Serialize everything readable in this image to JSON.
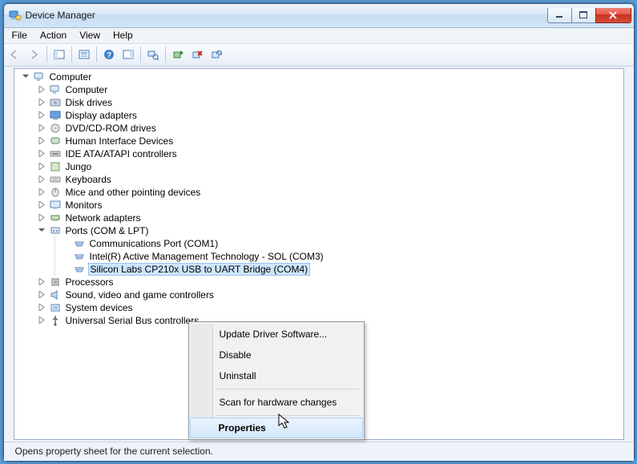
{
  "window": {
    "title": "Device Manager"
  },
  "menu": {
    "file": "File",
    "action": "Action",
    "view": "View",
    "help": "Help"
  },
  "tree": {
    "root": "Computer",
    "children": [
      "Computer",
      "Disk drives",
      "Display adapters",
      "DVD/CD-ROM drives",
      "Human Interface Devices",
      "IDE ATA/ATAPI controllers",
      "Jungo",
      "Keyboards",
      "Mice and other pointing devices",
      "Monitors",
      "Network adapters"
    ],
    "ports_label": "Ports (COM & LPT)",
    "ports": [
      "Communications Port (COM1)",
      "Intel(R) Active Management Technology - SOL (COM3)",
      "Silicon Labs CP210x USB to UART Bridge (COM4)"
    ],
    "after_ports": [
      "Processors",
      "Sound, video and game controllers",
      "System devices",
      "Universal Serial Bus controllers"
    ]
  },
  "context_menu": {
    "update": "Update Driver Software...",
    "disable": "Disable",
    "uninstall": "Uninstall",
    "scan": "Scan for hardware changes",
    "properties": "Properties"
  },
  "status": "Opens property sheet for the current selection."
}
